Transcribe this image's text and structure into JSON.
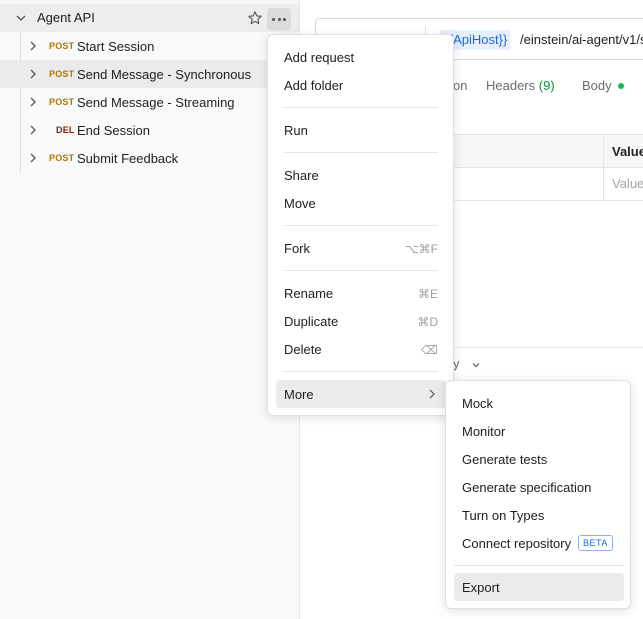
{
  "sidebar": {
    "collection": "Agent API",
    "requests": [
      {
        "method": "POST",
        "label": "Start Session"
      },
      {
        "method": "POST",
        "label": "Send Message - Synchronous"
      },
      {
        "method": "POST",
        "label": "Send Message - Streaming"
      },
      {
        "method": "DEL",
        "label": "End Session"
      },
      {
        "method": "POST",
        "label": "Submit Feedback"
      }
    ]
  },
  "main": {
    "url_variable": "sfApiHost}}",
    "url_path": "/einstein/ai-agent/v1/s",
    "tabs": {
      "tab1_fragment": "on",
      "headers_label": "Headers",
      "headers_count": "(9)",
      "body_label": "Body"
    },
    "table": {
      "value_header": "Value",
      "value_placeholder": "Value"
    },
    "response_fragment": "y"
  },
  "context_menu": {
    "items": {
      "add_request": "Add request",
      "add_folder": "Add folder",
      "run": "Run",
      "share": "Share",
      "move": "Move",
      "fork": "Fork",
      "fork_shortcut": "⌥⌘F",
      "rename": "Rename",
      "rename_shortcut": "⌘E",
      "duplicate": "Duplicate",
      "duplicate_shortcut": "⌘D",
      "delete": "Delete",
      "delete_shortcut": "⌫",
      "more": "More"
    }
  },
  "submenu": {
    "mock": "Mock",
    "monitor": "Monitor",
    "generate_tests": "Generate tests",
    "generate_spec": "Generate specification",
    "turn_on_types": "Turn on Types",
    "connect_repo": "Connect repository",
    "beta_badge": "BETA",
    "export": "Export"
  },
  "colors": {
    "post": "#ad7a03",
    "del": "#8e1a10",
    "accent": "#1a6ad3",
    "headers_count": "#0c8a3e",
    "body_dot": "#0cbb52"
  }
}
